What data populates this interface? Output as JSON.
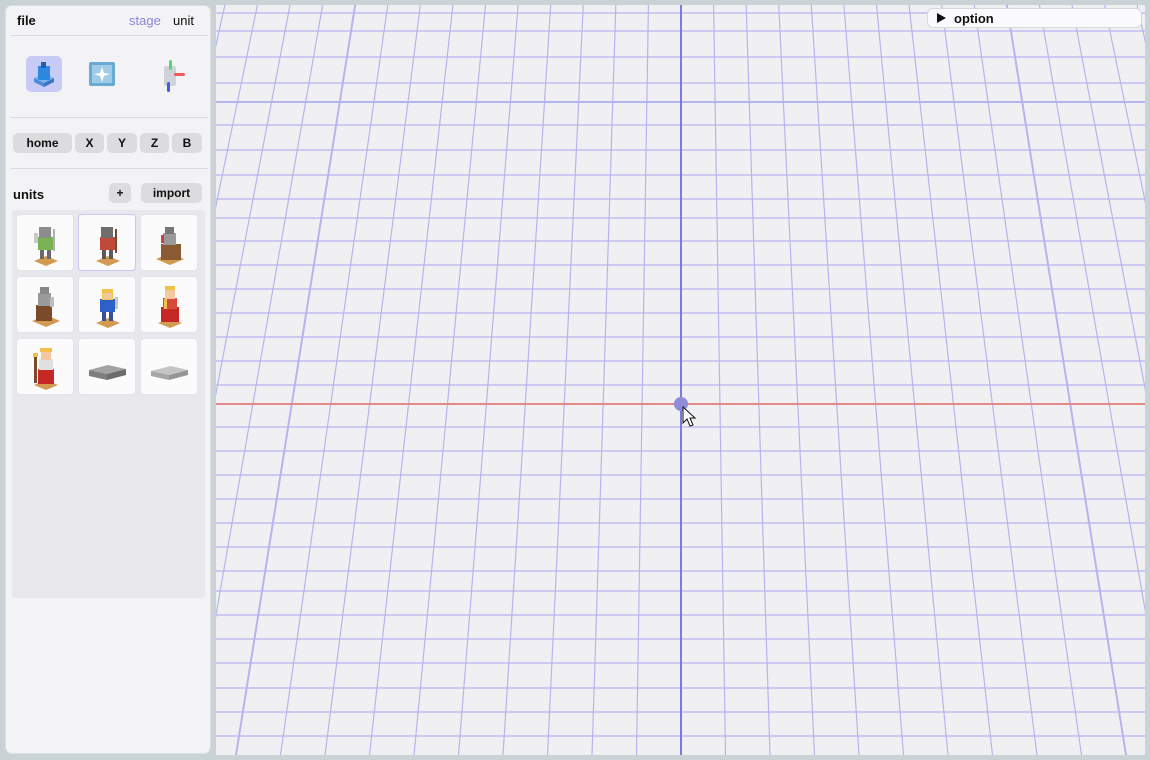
{
  "menu": {
    "file": "file",
    "stage": "stage",
    "unit": "unit"
  },
  "tools": [
    {
      "name": "place-block",
      "icon": "cube-cursor-icon",
      "active": true
    },
    {
      "name": "paint",
      "icon": "sparkle-block-icon",
      "active": false
    },
    {
      "name": "move-gizmo",
      "icon": "axis-gizmo-icon",
      "active": false
    }
  ],
  "camera": {
    "home": "home",
    "x": "X",
    "y": "Y",
    "z": "Z",
    "b": "B"
  },
  "units": {
    "label": "units",
    "add": "+",
    "import": "import",
    "items": [
      {
        "icon": "knight-green-icon",
        "selected": false
      },
      {
        "icon": "knight-red-icon",
        "selected": true
      },
      {
        "icon": "knight-crate-icon",
        "selected": false
      },
      {
        "icon": "knight-horse-icon",
        "selected": false
      },
      {
        "icon": "blonde-hero-icon",
        "selected": false
      },
      {
        "icon": "king-red-icon",
        "selected": false
      },
      {
        "icon": "wizard-icon",
        "selected": false
      },
      {
        "icon": "gray-slab-icon",
        "selected": false
      },
      {
        "icon": "light-slab-icon",
        "selected": false
      }
    ]
  },
  "viewport": {
    "option": "option",
    "colors": {
      "grid": "#b6b4ee",
      "axis_z": "#7b78ea",
      "axis_x": "#e08a8a",
      "origin": "#8e8bd8"
    }
  }
}
